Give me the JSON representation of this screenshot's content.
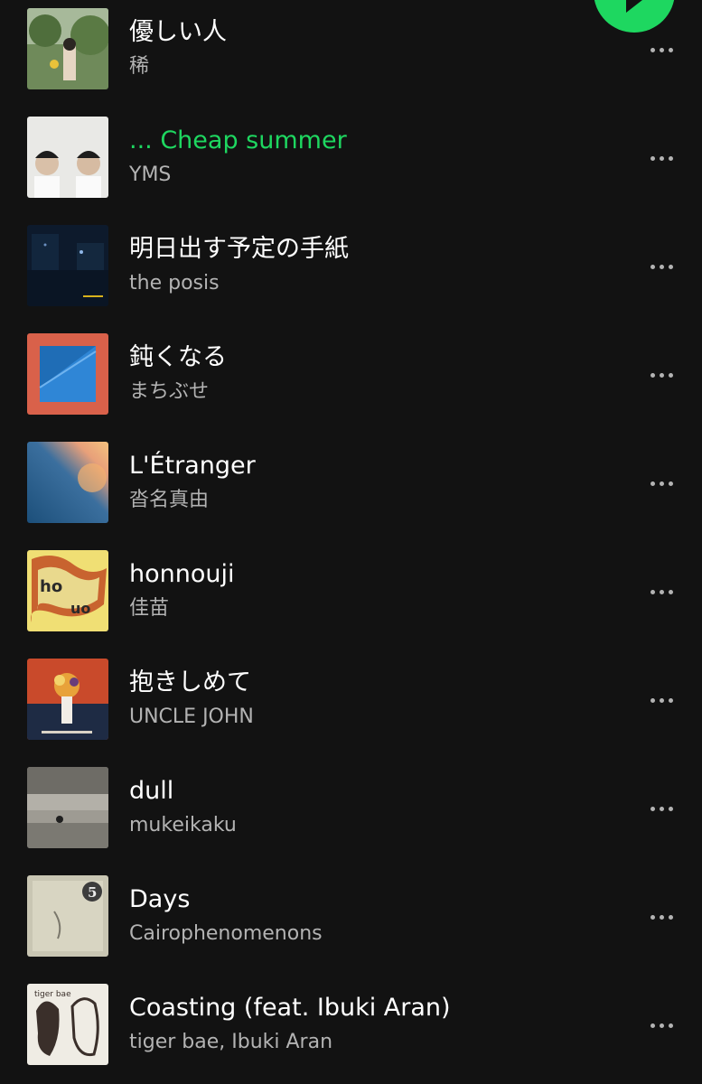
{
  "colors": {
    "background": "#121212",
    "accent": "#1ed760",
    "secondary_text": "#b3b3b3"
  },
  "play_button": {
    "icon": "play-icon"
  },
  "tracks": [
    {
      "title": "優しい人",
      "artist": "稀",
      "active": false
    },
    {
      "title": "... Cheap summer",
      "artist": "YMS",
      "active": true
    },
    {
      "title": "明日出す予定の手紙",
      "artist": "the posis",
      "active": false
    },
    {
      "title": "鈍くなる",
      "artist": "まちぶせ",
      "active": false
    },
    {
      "title": "L'Étranger",
      "artist": "沓名真由",
      "active": false
    },
    {
      "title": "honnouji",
      "artist": "佳苗",
      "active": false
    },
    {
      "title": "抱きしめて",
      "artist": "UNCLE JOHN",
      "active": false
    },
    {
      "title": "dull",
      "artist": "mukeikaku",
      "active": false
    },
    {
      "title": "Days",
      "artist": "Cairophenomenons",
      "active": false
    },
    {
      "title": "Coasting (feat. Ibuki Aran)",
      "artist": "tiger bae, Ibuki Aran",
      "active": false
    }
  ]
}
